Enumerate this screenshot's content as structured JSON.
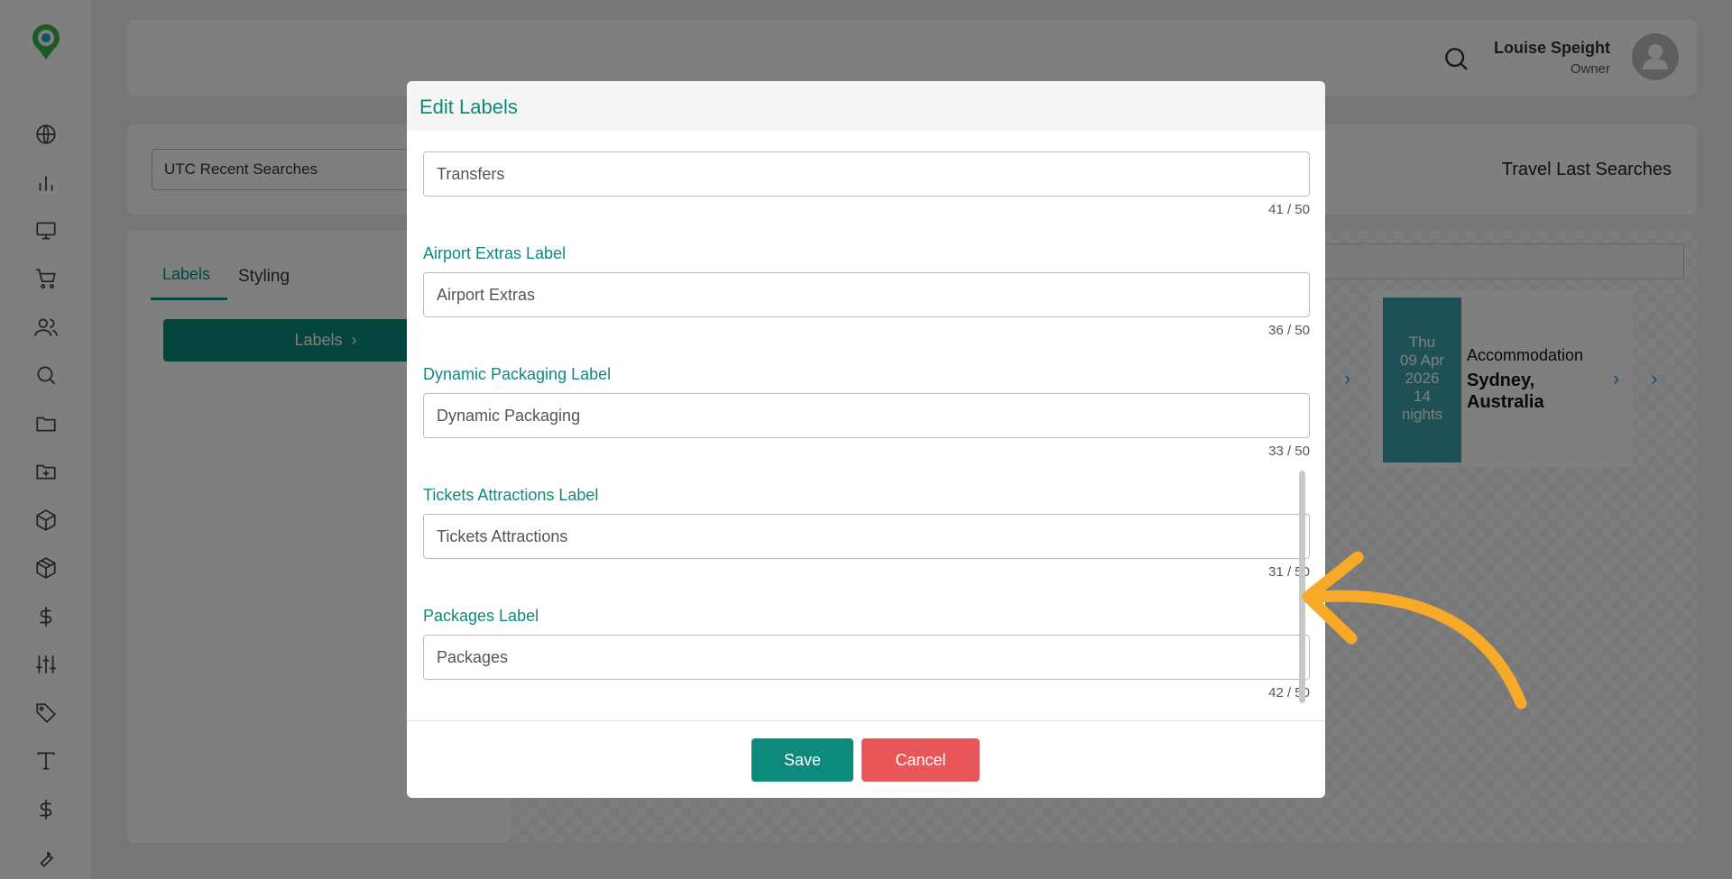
{
  "header": {
    "user_name": "Louise Speight",
    "user_role": "Owner"
  },
  "filter": {
    "selected": "UTC Recent Searches",
    "title": "Travel Last Searches"
  },
  "left_panel": {
    "tabs": [
      {
        "label": "Labels",
        "active": true
      },
      {
        "label": "Styling",
        "active": false
      }
    ],
    "labels_button": "Labels"
  },
  "preview_card": {
    "day": "Thu",
    "date": "09 Apr",
    "year": "2026",
    "nights_count": "14",
    "nights_label": "nights",
    "category": "Accommodation",
    "title": "Sydney, Australia"
  },
  "modal": {
    "title": "Edit Labels",
    "fields": [
      {
        "label": "",
        "value": "Transfers",
        "counter": "41 / 50"
      },
      {
        "label": "Airport Extras Label",
        "value": "Airport Extras",
        "counter": "36 / 50"
      },
      {
        "label": "Dynamic Packaging Label",
        "value": "Dynamic Packaging",
        "counter": "33 / 50"
      },
      {
        "label": "Tickets Attractions Label",
        "value": "Tickets Attractions",
        "counter": "31 / 50"
      },
      {
        "label": "Packages Label",
        "value": "Packages",
        "counter": "42 / 50"
      }
    ],
    "save_label": "Save",
    "cancel_label": "Cancel"
  },
  "colors": {
    "accent": "#0d8a7c",
    "danger": "#e85659",
    "annotation_arrow": "#f7a928",
    "card_date_bg": "#3aa3ad"
  },
  "sidebar": {
    "icons": [
      "globe-icon",
      "bar-chart-icon",
      "monitor-icon",
      "cart-icon",
      "users-icon",
      "search-icon",
      "folder-icon",
      "folder-plus-icon",
      "box-icon",
      "package-icon",
      "dollar-icon",
      "sliders-icon",
      "tag-icon",
      "type-icon",
      "dollar-icon",
      "wrench-icon"
    ]
  }
}
